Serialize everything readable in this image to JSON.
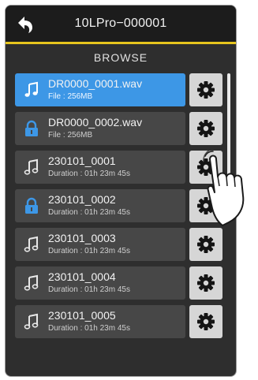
{
  "header": {
    "title": "10LPro−000001",
    "back_icon": "back-arrow-icon"
  },
  "section_title": "BROWSE",
  "colors": {
    "accent": "#e6c51e",
    "selected": "#3d97e6",
    "row": "#474747",
    "background": "#2e2e2e"
  },
  "items": [
    {
      "name": "DR0000_0001.wav",
      "meta": "File : 256MB",
      "icon": "music-note-icon",
      "selected": true
    },
    {
      "name": "DR0000_0002.wav",
      "meta": "File : 256MB",
      "icon": "lock-icon",
      "selected": false
    },
    {
      "name": "230101_0001",
      "meta": "Duration : 01h 23m 45s",
      "icon": "music-note-icon",
      "selected": false
    },
    {
      "name": "230101_0002",
      "meta": "Duration : 01h 23m 45s",
      "icon": "lock-icon",
      "selected": false
    },
    {
      "name": "230101_0003",
      "meta": "Duration : 01h 23m 45s",
      "icon": "music-note-icon",
      "selected": false
    },
    {
      "name": "230101_0004",
      "meta": "Duration : 01h 23m 45s",
      "icon": "music-note-icon",
      "selected": false
    },
    {
      "name": "230101_0005",
      "meta": "Duration : 01h 23m 45s",
      "icon": "music-note-icon",
      "selected": false
    }
  ],
  "item_action_icon": "gear-icon"
}
